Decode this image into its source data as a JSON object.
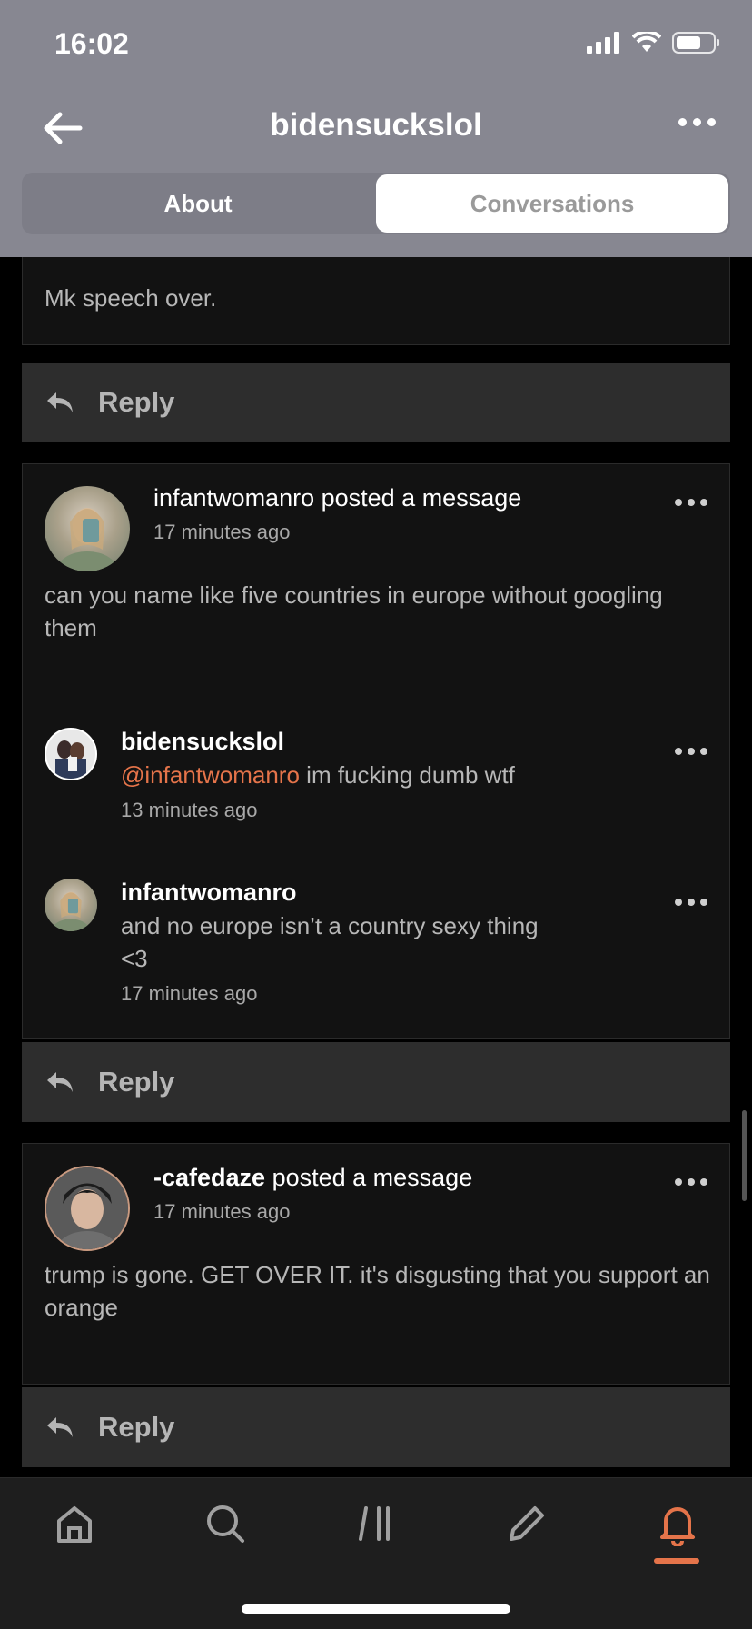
{
  "status": {
    "time": "16:02"
  },
  "header": {
    "title": "bidensuckslol"
  },
  "tabs": {
    "about": "About",
    "conversations": "Conversations"
  },
  "feed": {
    "top_fragment": {
      "text": "Mk speech over."
    },
    "reply_label": "Reply",
    "posts": [
      {
        "author": "infantwomanro",
        "action": " posted a message",
        "time": "17 minutes ago",
        "text": "can you name like five countries in europe without googling them",
        "comments": [
          {
            "author": "bidensuckslol",
            "mention": "@infantwomanro",
            "text": " im fucking dumb wtf",
            "time": "13 minutes ago"
          },
          {
            "author": "infantwomanro",
            "text_line1": "and no europe isn’t a country sexy thing",
            "text_line2": "<3",
            "time": "17 minutes ago"
          }
        ]
      },
      {
        "author": "-cafedaze",
        "action": " posted a message",
        "time": "17 minutes ago",
        "text": "trump is gone. GET OVER IT. it's disgusting that you support an orange"
      }
    ]
  },
  "colors": {
    "accent": "#e5744a",
    "header_bg": "#878791",
    "card_bg": "#121212"
  },
  "tabbar": {
    "items": [
      {
        "icon": "home-icon"
      },
      {
        "icon": "search-icon"
      },
      {
        "icon": "feeds-icon"
      },
      {
        "icon": "compose-icon"
      },
      {
        "icon": "notifications-icon",
        "active": true
      }
    ]
  }
}
